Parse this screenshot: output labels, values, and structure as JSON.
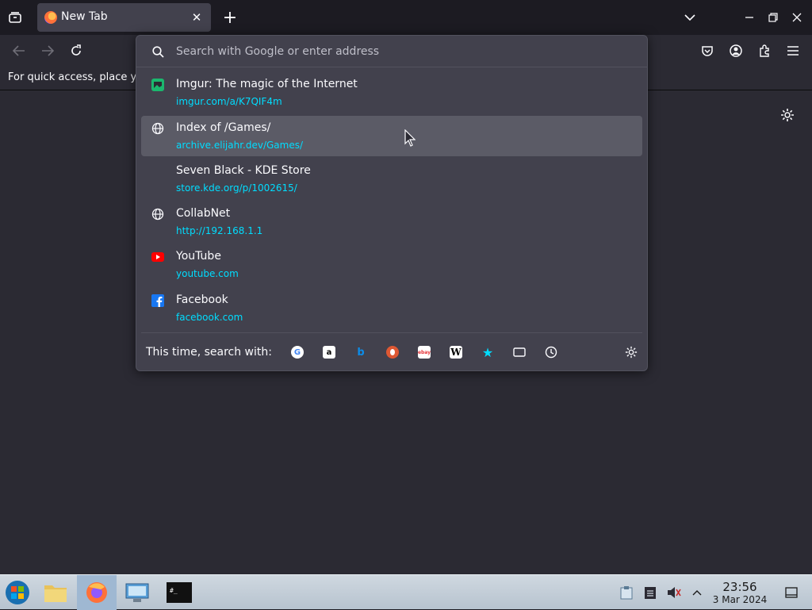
{
  "tab": {
    "title": "New Tab",
    "close": "✕"
  },
  "newtab_label": "+",
  "bookmarks_bar": {
    "hint": "For quick access, place y"
  },
  "urlbar": {
    "placeholder": "Search with Google or enter address",
    "results": [
      {
        "title": "Imgur: The magic of the Internet",
        "url": "imgur.com/a/K7QIF4m",
        "icon": "imgur-icon",
        "color": "#1bb76e"
      },
      {
        "title": "Index of /Games/",
        "url": "archive.elijahr.dev/Games/",
        "icon": "globe-icon",
        "highlighted": true
      },
      {
        "title": "Seven Black - KDE Store",
        "url": "store.kde.org/p/1002615/",
        "icon": "blank-icon"
      },
      {
        "title": "CollabNet",
        "url": "http://192.168.1.1",
        "icon": "globe-icon"
      },
      {
        "title": "YouTube",
        "url": "youtube.com",
        "icon": "youtube-icon",
        "color": "#ff0000"
      },
      {
        "title": "Facebook",
        "url": "facebook.com",
        "icon": "facebook-icon",
        "color": "#1877f2"
      }
    ],
    "oneoff_label": "This time, search with:",
    "engines": [
      {
        "name": "google-engine-icon",
        "glyph": "G",
        "bg": "#ffffff",
        "fg": "#4285f4"
      },
      {
        "name": "amazon-engine-icon",
        "glyph": "a",
        "bg": "#ffffff",
        "fg": "#000000"
      },
      {
        "name": "bing-engine-icon",
        "glyph": "b",
        "bg": "#42414d",
        "fg": "#0c8ce9"
      },
      {
        "name": "duckduckgo-engine-icon",
        "glyph": "●",
        "bg": "#de5833",
        "fg": "#ffffff"
      },
      {
        "name": "ebay-engine-icon",
        "glyph": "ebay",
        "bg": "#ffffff",
        "fg": "#e53238"
      },
      {
        "name": "wikipedia-engine-icon",
        "glyph": "W",
        "bg": "#ffffff",
        "fg": "#000000"
      },
      {
        "name": "bookmarks-engine-icon",
        "glyph": "★",
        "bg": "transparent",
        "fg": "#00ddff"
      },
      {
        "name": "tabs-engine-icon",
        "glyph": "▭",
        "bg": "transparent",
        "fg": "#fbfbfe"
      },
      {
        "name": "history-engine-icon",
        "glyph": "◷",
        "bg": "transparent",
        "fg": "#fbfbfe"
      }
    ]
  },
  "taskbar": {
    "time": "23:56",
    "date": "3 Mar 2024"
  }
}
